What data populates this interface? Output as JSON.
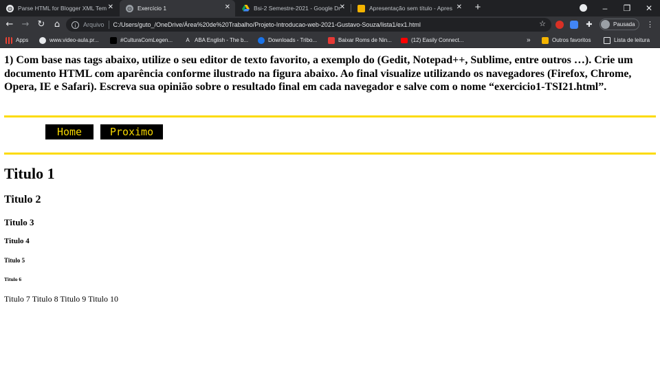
{
  "browser": {
    "tabs": [
      {
        "title": "Parse HTML for Blogger XML Tem",
        "icon": "globe-icon"
      },
      {
        "title": "Exercício 1",
        "icon": "globe-icon",
        "active": true
      },
      {
        "title": "Bsi-2 Semestre-2021 - Google Dr",
        "icon": "google-drive-icon"
      },
      {
        "title": "Apresentação sem título - Apres",
        "icon": "slides-icon"
      }
    ],
    "new_tab": "+",
    "window_controls": [
      "–",
      "❐",
      "✕"
    ],
    "address": {
      "scheme": "Arquivo",
      "url": "C:/Users/guto_/OneDrive/Área%20de%20Trabalho/Projeto-Introducao-web-2021-Gustavo-Souza/lista1/ex1.html"
    },
    "profile_label": "Pausada",
    "bookmarks": [
      {
        "label": "Apps",
        "icon": "apps-grid-icon"
      },
      {
        "label": "www.video-aula.pr...",
        "icon": "globe-icon"
      },
      {
        "label": "#CulturaComLegen...",
        "icon": "bookmark-icon"
      },
      {
        "label": "ABA English - The b...",
        "icon": "aba-icon"
      },
      {
        "label": "Downloads - Tribo...",
        "icon": "download-icon"
      },
      {
        "label": "Baixar Roms de Nin...",
        "icon": "rom-icon"
      },
      {
        "label": "(12) Easily Connect...",
        "icon": "youtube-icon"
      }
    ],
    "bookmarks_overflow": "»",
    "other_bookmarks": "Outros favoritos",
    "reading_list": "Lista de leitura"
  },
  "page": {
    "intro": "1) Com base nas tags abaixo, utilize o seu editor de texto favorito, a exemplo do (Gedit, Notepad++, Sublime, entre outros …). Crie um documento HTML com aparência conforme ilustrado na figura abaixo. Ao final visualize utilizando os navegadores (Firefox, Chrome, Opera, IE e Safari). Escreva sua opinião sobre o resultado final em cada navegador e salve com o nome “exercicio1-TSI21.html”.",
    "nav": {
      "home": "Home",
      "next": "Proximo"
    },
    "headings": [
      "Titulo 1",
      "Titulo 2",
      "Titulo 3",
      "Titulo 4",
      "Titulo 5",
      "Titulo 6"
    ],
    "plain_text": "Titulo 7 Titulo 8 Titulo 9 Titulo 10",
    "colors": {
      "rule": "#fcdb03",
      "button_bg": "#000000",
      "button_text": "#f5d600"
    }
  }
}
